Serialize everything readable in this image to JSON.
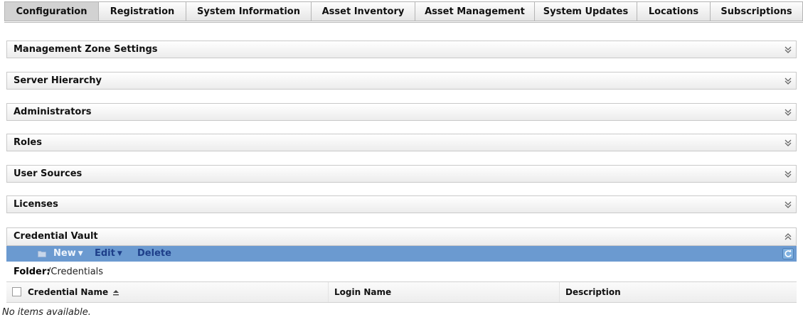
{
  "tabs": [
    {
      "label": "Configuration",
      "active": true
    },
    {
      "label": "Registration",
      "active": false
    },
    {
      "label": "System Information",
      "active": false
    },
    {
      "label": "Asset Inventory",
      "active": false
    },
    {
      "label": "Asset Management",
      "active": false
    },
    {
      "label": "System Updates",
      "active": false
    },
    {
      "label": "Locations",
      "active": false
    },
    {
      "label": "Subscriptions",
      "active": false
    }
  ],
  "panels": [
    {
      "title": "Management Zone Settings",
      "toggle_icon": "expand-icon"
    },
    {
      "title": "Server Hierarchy",
      "toggle_icon": "expand-icon"
    },
    {
      "title": "Administrators",
      "toggle_icon": "expand-icon"
    },
    {
      "title": "Roles",
      "toggle_icon": "expand-icon"
    },
    {
      "title": "User Sources",
      "toggle_icon": "expand-icon"
    },
    {
      "title": "Licenses",
      "toggle_icon": "expand-icon"
    }
  ],
  "credential_vault": {
    "title": "Credential Vault",
    "toggle_icon": "collapse-icon",
    "toolbar": {
      "folder_icon": "folder-icon",
      "new_label": "New",
      "edit_label": "Edit",
      "delete_label": "Delete",
      "refresh_icon": "refresh-icon"
    },
    "folder_label": "Folder:",
    "folder_path": "/Credentials",
    "columns": {
      "name": "Credential Name",
      "login": "Login Name",
      "description": "Description"
    },
    "empty_message": "No items available."
  },
  "colors": {
    "toolbar_bg": "#6b9ad0",
    "toolbar_link": "#1e3f8a",
    "active_tab": "#d2d2d2"
  }
}
